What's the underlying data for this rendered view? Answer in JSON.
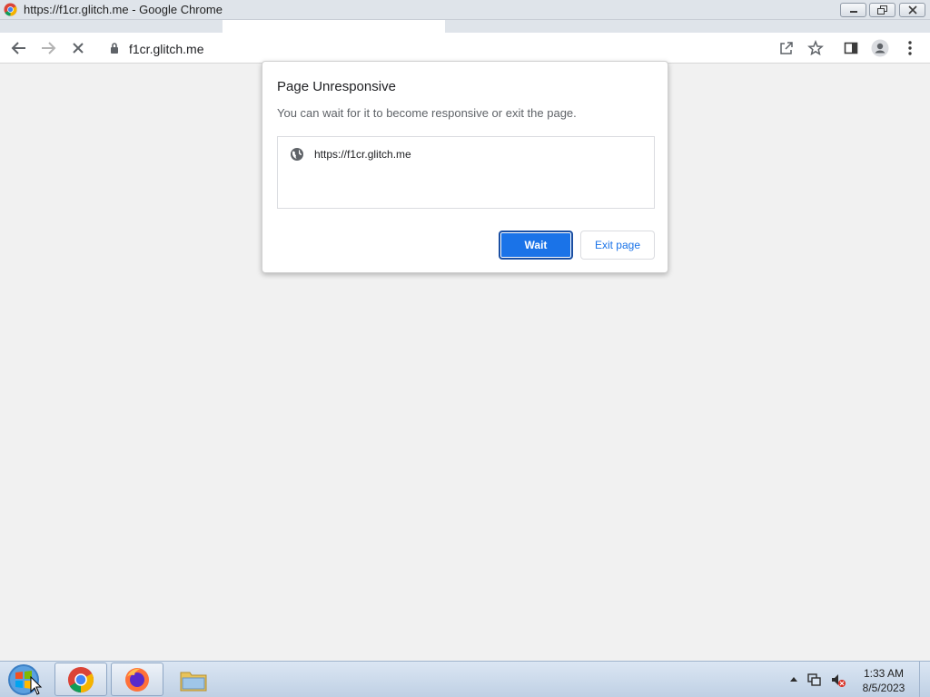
{
  "window": {
    "title": "https://f1cr.glitch.me - Google Chrome",
    "icon": "chrome-icon"
  },
  "toolbar": {
    "back_icon": "back-arrow-icon",
    "forward_icon": "forward-arrow-icon",
    "stop_icon": "stop-icon",
    "lock_icon": "lock-icon",
    "url": "f1cr.glitch.me",
    "share_icon": "share-icon",
    "bookmark_icon": "star-icon",
    "sidepanel_icon": "side-panel-icon",
    "profile_icon": "profile-icon",
    "menu_icon": "kebab-menu-icon"
  },
  "dialog": {
    "title": "Page Unresponsive",
    "message": "You can wait for it to become responsive or exit the page.",
    "site": "https://f1cr.glitch.me",
    "wait_label": "Wait",
    "exit_label": "Exit page"
  },
  "taskbar": {
    "items": [
      "start-button",
      "chrome",
      "firefox",
      "file-explorer"
    ],
    "time": "1:33 AM",
    "date": "8/5/2023"
  },
  "colors": {
    "accent": "#1a73e8",
    "background": "#f1f1f1"
  }
}
